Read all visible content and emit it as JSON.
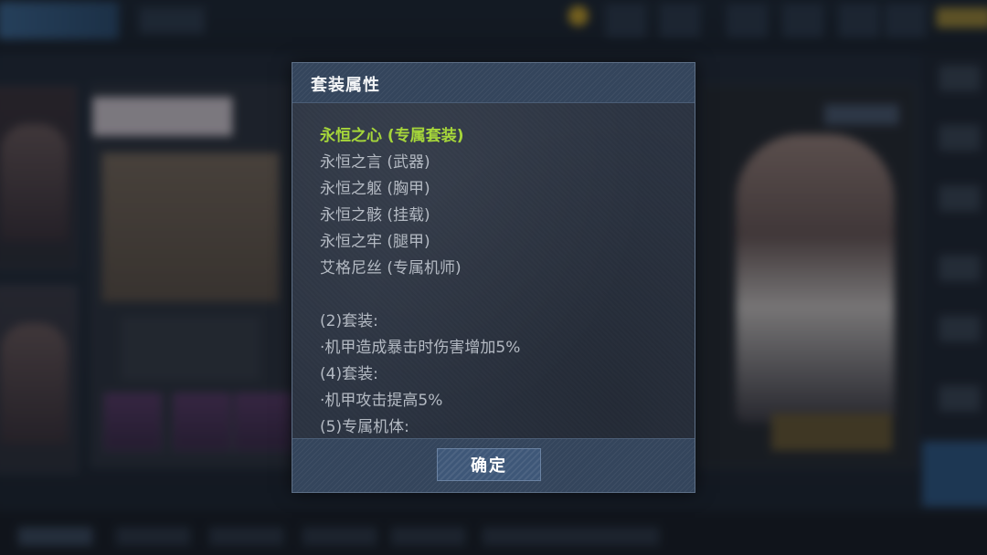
{
  "dialog": {
    "title": "套装属性",
    "set_name": "永恒之心 (专属套装)",
    "pieces": [
      "永恒之言 (武器)",
      "永恒之躯 (胸甲)",
      "永恒之骸 (挂载)",
      "永恒之牢 (腿甲)",
      "艾格尼丝 (专属机师)"
    ],
    "bonuses": [
      {
        "header": "(2)套装:",
        "effect": "·机甲造成暴击时伤害增加5%"
      },
      {
        "header": "(4)套装:",
        "effect": "·机甲攻击提高5%"
      },
      {
        "header": "(5)专属机体:"
      }
    ],
    "confirm_label": "确定"
  },
  "colors": {
    "set_name": "#a6d63a",
    "text": "#b4bac3",
    "panel": "#2c3442",
    "header": "#34455c",
    "button": "#3e5778"
  }
}
